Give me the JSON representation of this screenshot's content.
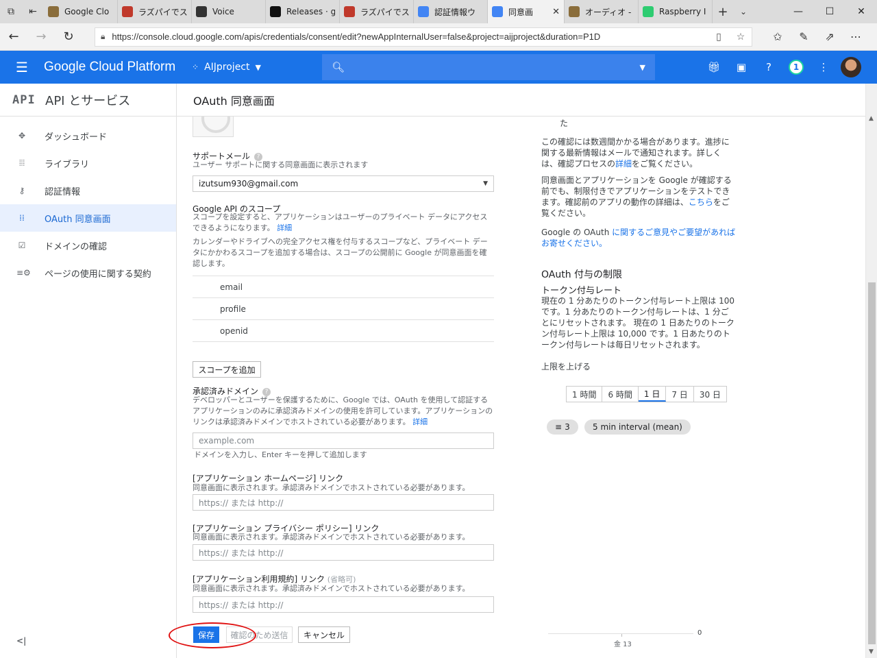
{
  "browser": {
    "tabs": [
      {
        "label": "Google Clo",
        "color": "#8a6d3b"
      },
      {
        "label": "ラズパイでス",
        "color": "#c0392b"
      },
      {
        "label": "Voice",
        "color": "#333333"
      },
      {
        "label": "Releases · g",
        "color": "#111111"
      },
      {
        "label": "ラズパイでス",
        "color": "#c0392b"
      },
      {
        "label": "認証情報ウ",
        "color": "#4285f4"
      },
      {
        "label": "同意画",
        "color": "#4285f4",
        "active": true
      },
      {
        "label": "オーディオ - F",
        "color": "#8a6d3b"
      },
      {
        "label": "Raspberry I",
        "color": "#2ecc71"
      }
    ],
    "url": "https://console.cloud.google.com/apis/credentials/consent/edit?newAppInternalUser=false&project=aijproject&duration=P1D"
  },
  "header": {
    "brand": "Google Cloud Platform",
    "project": "AIJproject",
    "notif_count": "1"
  },
  "sidebar": {
    "logo": "API",
    "title": "API とサービス",
    "items": [
      {
        "label": "ダッシュボード",
        "icon": "dashboard-icon",
        "glyph": "✥"
      },
      {
        "label": "ライブラリ",
        "icon": "library-icon",
        "glyph": "⦙⦙⦙"
      },
      {
        "label": "認証情報",
        "icon": "key-icon",
        "glyph": "⚷"
      },
      {
        "label": "OAuth 同意画面",
        "icon": "consent-icon",
        "glyph": "⁞⁞",
        "active": true
      },
      {
        "label": "ドメインの確認",
        "icon": "checkbox-icon",
        "glyph": "☑"
      },
      {
        "label": "ページの使用に関する契約",
        "icon": "settings-list-icon",
        "glyph": "≡⚙"
      }
    ],
    "collapse": "<|"
  },
  "main": {
    "title": "OAuth 同意画面"
  },
  "form": {
    "support_email_label": "サポートメール",
    "support_email_desc": "ユーザー サポートに関する同意画面に表示されます",
    "support_email_value": "izutsum930@gmail.com",
    "scopes_label": "Google API のスコープ",
    "scopes_desc1": "スコープを設定すると、アプリケーションはユーザーのプライベート データにアクセスできるようになります。",
    "scopes_desc1_link": "詳細",
    "scopes_desc2": "カレンダーやドライブへの完全アクセス権を付与するスコープなど、プライベート データにかかわるスコープを追加する場合は、スコープの公開前に Google が同意画面を確認します。",
    "scopes": [
      "email",
      "profile",
      "openid"
    ],
    "add_scope": "スコープを追加",
    "domains_label": "承認済みドメイン",
    "domains_desc": "デベロッパーとユーザーを保護するために、Google では、OAuth を使用して認証するアプリケーションのみに承認済みドメインの使用を許可しています。アプリケーションのリンクは承認済みドメインでホストされている必要があります。",
    "domains_desc_link": "詳細",
    "domains_placeholder": "example.com",
    "domains_hint": "ドメインを入力し、Enter キーを押して追加します",
    "homepage_label": "[アプリケーション ホームページ] リンク",
    "homepage_desc": "同意画面に表示されます。承認済みドメインでホストされている必要があります。",
    "homepage_placeholder": "https:// または http://",
    "privacy_label": "[アプリケーション プライバシー ポリシー] リンク",
    "privacy_desc": "同意画面に表示されます。承認済みドメインでホストされている必要があります。",
    "privacy_placeholder": "https:// または http://",
    "tos_label": "[アプリケーション利用規約] リンク",
    "tos_optional": "(省略可)",
    "tos_desc": "同意画面に表示されます。承認済みドメインでホストされている必要があります。",
    "tos_placeholder": "https:// または http://",
    "save": "保存",
    "submit": "確認のため送信",
    "cancel": "キャンセル"
  },
  "right": {
    "frag": "た",
    "p1_a": "この確認には数週間かかる場合があります。進捗に関する最新情報はメールで通知されます。詳しくは、確認プロセスの",
    "p1_link": "詳細",
    "p1_b": "をご覧ください。",
    "p2_a": "同意画面とアプリケーションを Google が確認する前でも、制限付きでアプリケーションをテストできます。確認前のアプリの動作の詳細は、",
    "p2_link": "こちら",
    "p2_b": "をご覧ください。",
    "p3_a": "Google の OAuth ",
    "p3_link": "に関するご意見やご要望があればお寄せください。",
    "grant_title": "OAuth 付与の制限",
    "rate_title": "トークン付与レート",
    "rate_desc": "現在の 1 分あたりのトークン付与レート上限は 100 です。1 分あたりのトークン付与レートは、1 分ごとにリセットされます。 現在の 1 日あたりのトークン付与レート上限は 10,000 です。1 日あたりのトークン付与レートは毎日リセットされます。",
    "raise_limit": "上限を上げる",
    "ranges": [
      "1 時間",
      "6 時間",
      "1 日",
      "7 日",
      "30 日"
    ],
    "active_range": "1 日",
    "filter_chip": "3",
    "interval_chip": "5 min interval (mean)",
    "chart_zero": "0",
    "chart_x": "金 13"
  }
}
